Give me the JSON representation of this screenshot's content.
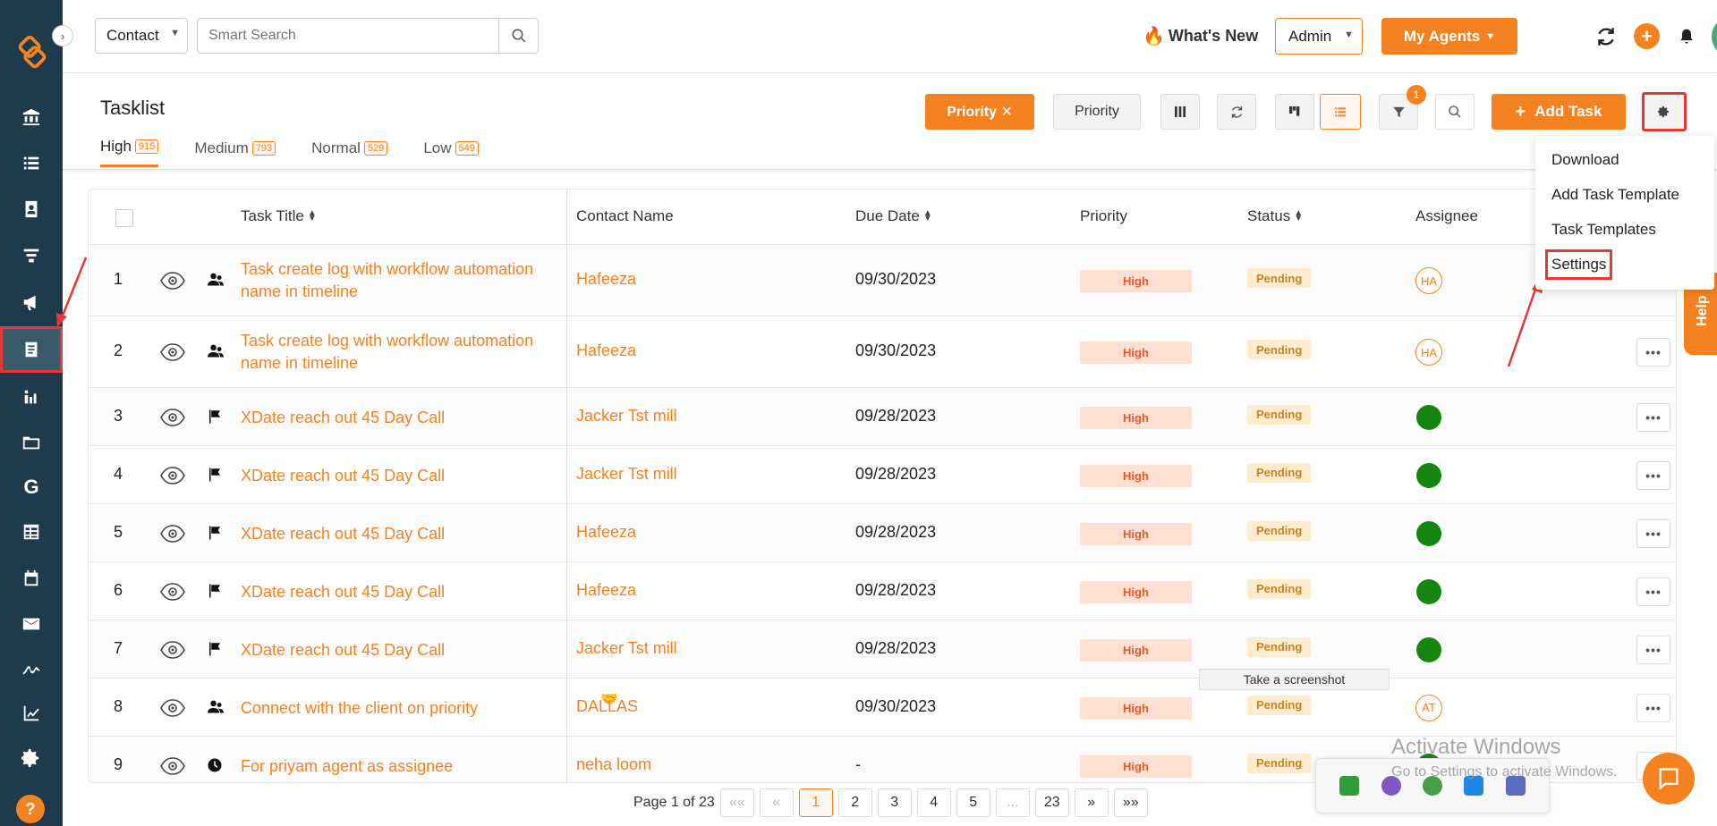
{
  "topbar": {
    "contact_select": "Contact",
    "search_placeholder": "Smart Search",
    "whats_new": "What's New",
    "role_select": "Admin",
    "my_agents": "My Agents"
  },
  "header": {
    "title": "Tasklist",
    "tabs": [
      {
        "label": "High",
        "count": "915"
      },
      {
        "label": "Medium",
        "count": "793"
      },
      {
        "label": "Normal",
        "count": "529"
      },
      {
        "label": "Low",
        "count": "549"
      }
    ],
    "priority_active_btn": "Priority ✕",
    "priority_btn": "Priority",
    "filter_badge": "1",
    "add_task": "Add Task"
  },
  "settings_menu": {
    "items": [
      "Download",
      "Add Task Template",
      "Task Templates",
      "Settings"
    ]
  },
  "table": {
    "columns": {
      "title": "Task Title",
      "contact": "Contact Name",
      "due": "Due Date",
      "priority": "Priority",
      "status": "Status",
      "assignee": "Assignee"
    },
    "rows": [
      {
        "num": "1",
        "type": "contact-icon",
        "title_l1": "Task create log with workflow automation",
        "title_l2": "name in timeline",
        "contact": "Hafeeza",
        "due": "09/30/2023",
        "priority": "High",
        "status": "Pending",
        "assignee": "HA"
      },
      {
        "num": "2",
        "type": "contact-icon",
        "title_l1": "Task create log with workflow automation",
        "title_l2": "name in timeline",
        "contact": "Hafeeza",
        "due": "09/30/2023",
        "priority": "High",
        "status": "Pending",
        "assignee": "HA"
      },
      {
        "num": "3",
        "type": "flag-icon",
        "title_l1": "XDate reach out 45 Day Call",
        "title_l2": "",
        "contact": "Jacker Tst mill",
        "due": "09/28/2023",
        "priority": "High",
        "status": "Pending",
        "assignee": ""
      },
      {
        "num": "4",
        "type": "flag-icon",
        "title_l1": "XDate reach out 45 Day Call",
        "title_l2": "",
        "contact": "Jacker Tst mill",
        "due": "09/28/2023",
        "priority": "High",
        "status": "Pending",
        "assignee": ""
      },
      {
        "num": "5",
        "type": "flag-icon",
        "title_l1": "XDate reach out 45 Day Call",
        "title_l2": "",
        "contact": "Hafeeza",
        "due": "09/28/2023",
        "priority": "High",
        "status": "Pending",
        "assignee": ""
      },
      {
        "num": "6",
        "type": "flag-icon",
        "title_l1": "XDate reach out 45 Day Call",
        "title_l2": "",
        "contact": "Hafeeza",
        "due": "09/28/2023",
        "priority": "High",
        "status": "Pending",
        "assignee": ""
      },
      {
        "num": "7",
        "type": "flag-icon",
        "title_l1": "XDate reach out 45 Day Call",
        "title_l2": "",
        "contact": "Jacker Tst mill",
        "due": "09/28/2023",
        "priority": "High",
        "status": "Pending",
        "assignee": ""
      },
      {
        "num": "8",
        "type": "contact-icon",
        "title_l1": "Connect with the client on priority",
        "title_l2": "",
        "contact": "DALLAS",
        "due": "09/30/2023",
        "priority": "High",
        "status": "Pending",
        "assignee": "AT"
      },
      {
        "num": "9",
        "type": "clock-icon",
        "title_l1": "For priyam agent as assignee",
        "title_l2": "",
        "contact": "neha loom",
        "due": "-",
        "priority": "High",
        "status": "Pending",
        "assignee": ""
      }
    ]
  },
  "pager": {
    "label": "Page 1 of 23",
    "first": "««",
    "prev": "«",
    "pages": [
      "1",
      "2",
      "3",
      "4",
      "5",
      "...",
      "23"
    ],
    "next": "»",
    "last": "»»"
  },
  "help_tab": "Help",
  "tooltip": "Take a screenshot",
  "watermark": {
    "title": "Activate Windows",
    "subtitle": "Go to Settings to activate Windows."
  },
  "colors": {
    "accent": "#f58220",
    "sidebar": "#1f3a4a",
    "highlight": "#e53935"
  }
}
